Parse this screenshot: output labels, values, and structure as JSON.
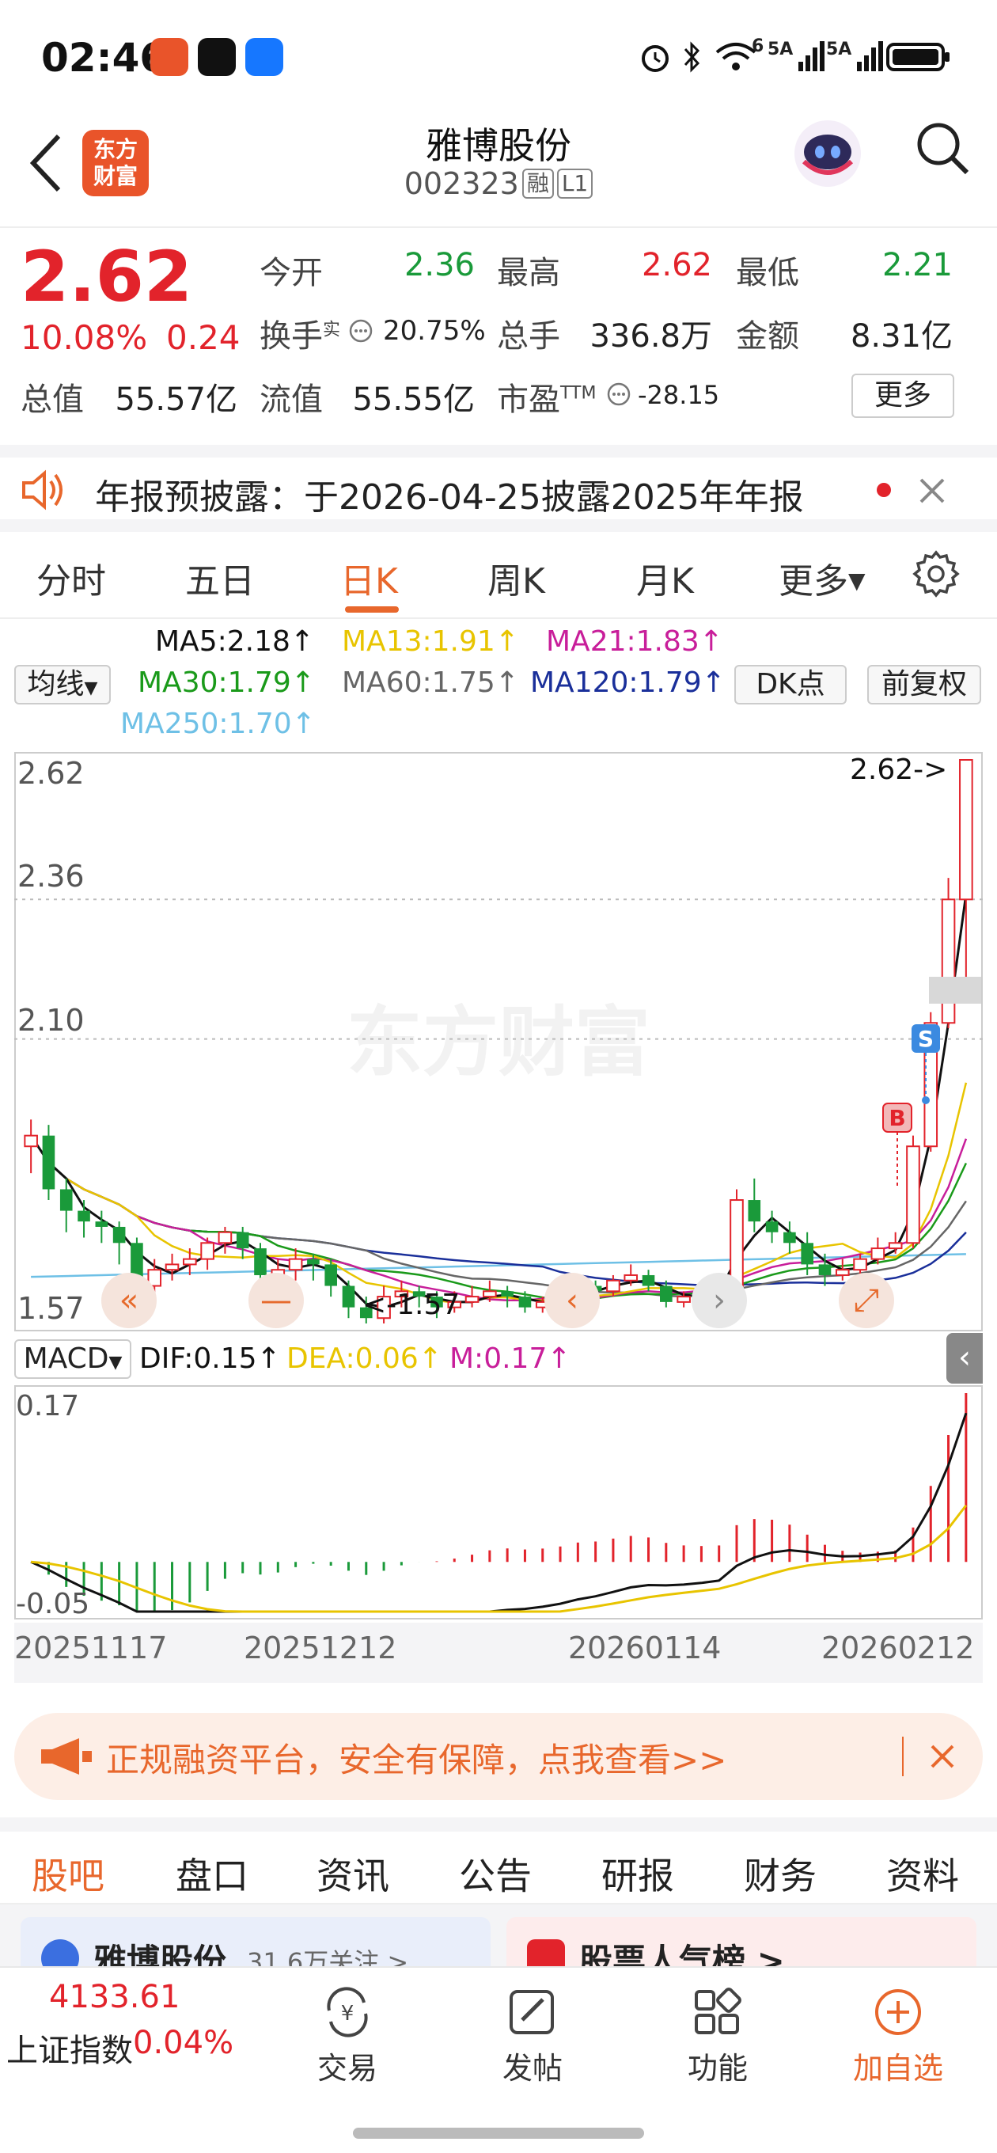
{
  "status": {
    "time": "02:46",
    "signal1": "5A",
    "signal2": "5A",
    "wifi_badge": "6"
  },
  "header": {
    "logo_line1": "东方",
    "logo_line2": "财富",
    "stock_name": "雅博股份",
    "stock_code": "002323",
    "tag_margin": "融",
    "tag_level": "L1"
  },
  "quote": {
    "price": "2.62",
    "change_pct": "10.08%",
    "change_amt": "0.24",
    "open_label": "今开",
    "open_value": "2.36",
    "high_label": "最高",
    "high_value": "2.62",
    "low_label": "最低",
    "low_value": "2.21",
    "turnover_label": "换手",
    "turnover_sup": "实",
    "turnover_value": "20.75%",
    "volume_label": "总手",
    "volume_value": "336.8万",
    "amount_label": "金额",
    "amount_value": "8.31亿",
    "mcap_label": "总值",
    "mcap_value": "55.57亿",
    "float_label": "流值",
    "float_value": "55.55亿",
    "pe_label": "市盈",
    "pe_sup": "TTM",
    "pe_value": "-28.15",
    "more_button": "更多"
  },
  "notice": {
    "text": "年报预披露：于2026-04-25披露2025年年报"
  },
  "period_tabs": [
    "分时",
    "五日",
    "日K",
    "周K",
    "月K",
    "更多"
  ],
  "ma_legend": {
    "ma_select": "均线",
    "ma5": "MA5:2.18↑",
    "ma13": "MA13:1.91↑",
    "ma21": "MA21:1.83↑",
    "ma30": "MA30:1.79↑",
    "ma60": "MA60:1.75↑",
    "ma120": "MA120:1.79↑",
    "ma250": "MA250:1.70↑",
    "dk_button": "DK点",
    "fq_button": "前复权"
  },
  "colors": {
    "up": "#e2232b",
    "down": "#1a9a3a",
    "ma5": "#111111",
    "ma13": "#e8c400",
    "ma21": "#c81e9a",
    "ma30": "#1a9a1a",
    "ma60": "#666666",
    "ma120": "#1a2f9a",
    "ma250": "#6ec0e6",
    "accent": "#e8672c"
  },
  "chart_data": [
    {
      "type": "candlestick",
      "y_ticks": [
        "2.62",
        "2.36",
        "2.10",
        "1.57"
      ],
      "ylim": [
        1.57,
        2.62
      ],
      "high_label": "2.62->",
      "low_label": "<-1.57",
      "markers": [
        "B",
        "S"
      ],
      "watermark": "东方财富",
      "candles": [
        [
          1.9,
          1.92,
          1.95,
          1.85
        ],
        [
          1.92,
          1.82,
          1.94,
          1.8
        ],
        [
          1.82,
          1.78,
          1.84,
          1.74
        ],
        [
          1.78,
          1.76,
          1.8,
          1.73
        ],
        [
          1.76,
          1.75,
          1.78,
          1.72
        ],
        [
          1.75,
          1.72,
          1.76,
          1.68
        ],
        [
          1.72,
          1.64,
          1.73,
          1.62
        ],
        [
          1.64,
          1.67,
          1.69,
          1.62
        ],
        [
          1.67,
          1.68,
          1.7,
          1.65
        ],
        [
          1.68,
          1.69,
          1.71,
          1.66
        ],
        [
          1.69,
          1.72,
          1.73,
          1.67
        ],
        [
          1.72,
          1.74,
          1.75,
          1.7
        ],
        [
          1.74,
          1.71,
          1.75,
          1.69
        ],
        [
          1.71,
          1.66,
          1.72,
          1.64
        ],
        [
          1.66,
          1.67,
          1.69,
          1.64
        ],
        [
          1.67,
          1.69,
          1.71,
          1.65
        ],
        [
          1.69,
          1.68,
          1.7,
          1.65
        ],
        [
          1.68,
          1.64,
          1.69,
          1.62
        ],
        [
          1.64,
          1.6,
          1.65,
          1.58
        ],
        [
          1.6,
          1.58,
          1.62,
          1.57
        ],
        [
          1.58,
          1.62,
          1.64,
          1.57
        ],
        [
          1.62,
          1.63,
          1.65,
          1.6
        ],
        [
          1.63,
          1.62,
          1.64,
          1.6
        ],
        [
          1.62,
          1.6,
          1.63,
          1.58
        ],
        [
          1.6,
          1.61,
          1.63,
          1.59
        ],
        [
          1.61,
          1.62,
          1.64,
          1.6
        ],
        [
          1.62,
          1.63,
          1.65,
          1.61
        ],
        [
          1.63,
          1.62,
          1.64,
          1.6
        ],
        [
          1.62,
          1.6,
          1.63,
          1.59
        ],
        [
          1.6,
          1.61,
          1.62,
          1.59
        ],
        [
          1.61,
          1.62,
          1.64,
          1.6
        ],
        [
          1.62,
          1.64,
          1.65,
          1.61
        ],
        [
          1.64,
          1.63,
          1.65,
          1.61
        ],
        [
          1.63,
          1.65,
          1.66,
          1.62
        ],
        [
          1.65,
          1.66,
          1.68,
          1.64
        ],
        [
          1.66,
          1.64,
          1.67,
          1.63
        ],
        [
          1.64,
          1.61,
          1.65,
          1.6
        ],
        [
          1.61,
          1.62,
          1.63,
          1.6
        ],
        [
          1.62,
          1.63,
          1.64,
          1.61
        ],
        [
          1.63,
          1.64,
          1.66,
          1.62
        ],
        [
          1.64,
          1.8,
          1.82,
          1.63
        ],
        [
          1.8,
          1.76,
          1.84,
          1.74
        ],
        [
          1.76,
          1.74,
          1.78,
          1.72
        ],
        [
          1.74,
          1.72,
          1.76,
          1.7
        ],
        [
          1.72,
          1.68,
          1.74,
          1.66
        ],
        [
          1.68,
          1.66,
          1.7,
          1.64
        ],
        [
          1.66,
          1.67,
          1.69,
          1.65
        ],
        [
          1.67,
          1.69,
          1.7,
          1.66
        ],
        [
          1.69,
          1.71,
          1.73,
          1.68
        ],
        [
          1.71,
          1.72,
          1.74,
          1.7
        ],
        [
          1.72,
          1.9,
          1.92,
          1.71
        ],
        [
          1.9,
          2.13,
          2.15,
          1.89
        ],
        [
          2.13,
          2.36,
          2.4,
          2.12
        ],
        [
          2.36,
          2.62,
          2.62,
          2.21
        ]
      ]
    },
    {
      "type": "macd",
      "legend_select": "MACD",
      "dif": "DIF:0.15↑",
      "dea": "DEA:0.06↑",
      "m": "M:0.17↑",
      "y_ticks": [
        "0.17",
        "-0.05"
      ],
      "ylim": [
        -0.05,
        0.17
      ],
      "x_ticks": [
        "20251117",
        "20251212",
        "20260114",
        "20260212"
      ]
    }
  ],
  "promo": {
    "text": "正规融资平台，安全有保障，点我查看>>"
  },
  "bottom_tabs": [
    "股吧",
    "盘口",
    "资讯",
    "公告",
    "研报",
    "财务",
    "资料"
  ],
  "under_strip": {
    "left_title": "雅博股份",
    "left_sub": "31.6万关注 >",
    "right_title": "股票人气榜 >"
  },
  "nav": {
    "index_value": "4133.61",
    "index_name": "上证指数",
    "index_change": "0.04%",
    "trade": "交易",
    "post": "发帖",
    "func": "功能",
    "add": "加自选"
  }
}
